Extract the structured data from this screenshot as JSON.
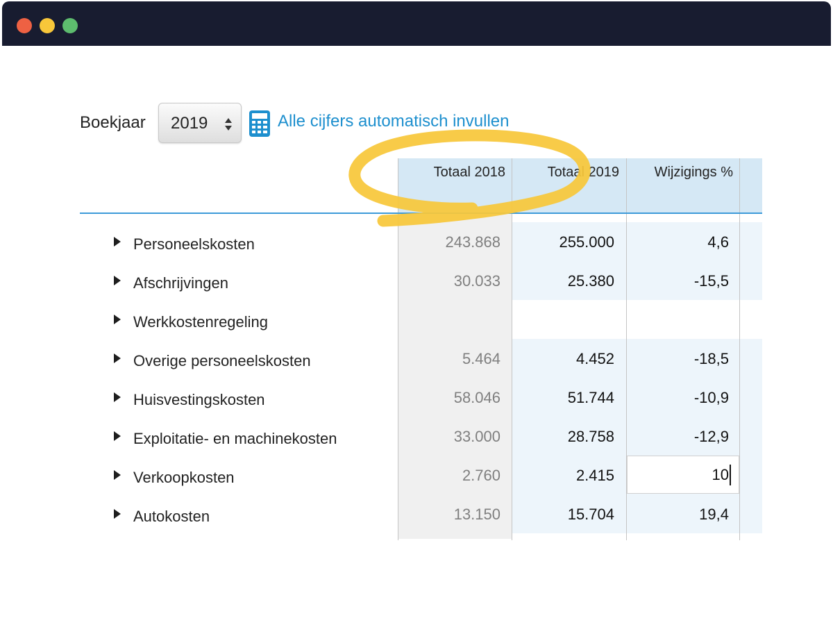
{
  "toolbar": {
    "year_label": "Boekjaar",
    "year_value": "2019",
    "autofill_label": "Alle cijfers automatisch invullen"
  },
  "table": {
    "headers": [
      "Totaal 2018",
      "Totaal 2019",
      "Wijzigings %"
    ],
    "rows": [
      {
        "label": "Personeelskosten",
        "y2018": "243.868",
        "y2019": "255.000",
        "pct": "4,6"
      },
      {
        "label": "Afschrijvingen",
        "y2018": "30.033",
        "y2019": "25.380",
        "pct": "-15,5"
      },
      {
        "label": "Werkkostenregeling",
        "y2018": "",
        "y2019": "",
        "pct": ""
      },
      {
        "label": "Overige personeelskosten",
        "y2018": "5.464",
        "y2019": "4.452",
        "pct": "-18,5"
      },
      {
        "label": "Huisvestingskosten",
        "y2018": "58.046",
        "y2019": "51.744",
        "pct": "-10,9"
      },
      {
        "label": "Exploitatie- en machinekosten",
        "y2018": "33.000",
        "y2019": "28.758",
        "pct": "-12,9"
      },
      {
        "label": "Verkoopkosten",
        "y2018": "2.760",
        "y2019": "2.415",
        "pct": "10"
      },
      {
        "label": "Autokosten",
        "y2018": "13.150",
        "y2019": "15.704",
        "pct": "19,4"
      }
    ]
  },
  "colors": {
    "accent": "#1d8fce",
    "header_bg": "#d5e8f5",
    "annotation": "#f8c73a"
  }
}
